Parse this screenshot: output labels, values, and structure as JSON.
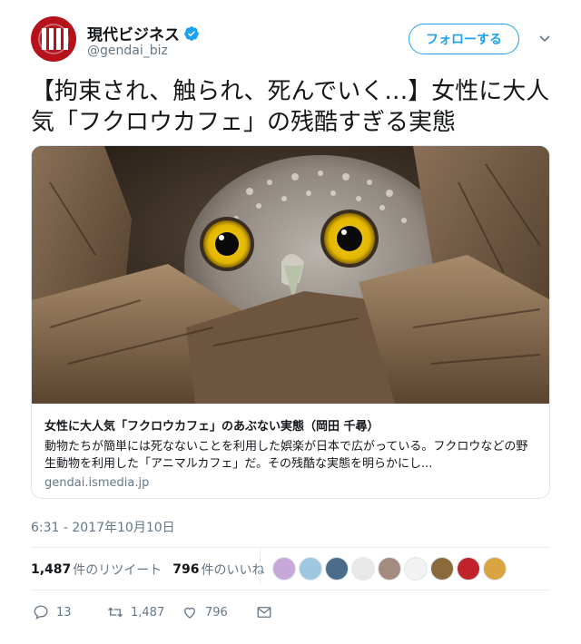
{
  "account": {
    "display_name": "現代ビジネス",
    "handle": "@gendai_biz",
    "verified": true,
    "avatar_color": "#b5121b"
  },
  "follow_button": {
    "label": "フォローする",
    "color": "#1da1f2"
  },
  "tweet": {
    "text": "【拘束され、触られ、死んでいく…】女性に大人気「フクロウカフェ」の残酷すぎる実態"
  },
  "card": {
    "image": "owl-peeking-from-tree-hollow",
    "title": "女性に大人気「フクロウカフェ」のあぶない実態（岡田 千尋）",
    "description": "動物たちが簡単には死なないことを利用した娯楽が日本で広がっている。フクロウなどの野生動物を利用した「アニマルカフェ」だ。その残酷な実態を明らかにし...",
    "domain": "gendai.ismedia.jp"
  },
  "timestamp": "6:31 - 2017年10月10日",
  "stats": {
    "retweets_count": "1,487",
    "retweets_label": "件のリツイート",
    "likes_count": "796",
    "likes_label": "件のいいね"
  },
  "likers": [
    {
      "icon": "liker-avatar",
      "color": "#c7a8d9"
    },
    {
      "icon": "liker-avatar",
      "color": "#9fc7e0"
    },
    {
      "icon": "liker-avatar",
      "color": "#4a6b8a"
    },
    {
      "icon": "liker-avatar",
      "color": "#e8e8e8"
    },
    {
      "icon": "liker-avatar",
      "color": "#a58b7d"
    },
    {
      "icon": "liker-avatar",
      "color": "#f2f2f2"
    },
    {
      "icon": "liker-avatar",
      "color": "#8a6a3a"
    },
    {
      "icon": "liker-avatar",
      "color": "#c0242a"
    },
    {
      "icon": "liker-avatar",
      "color": "#d9a441"
    }
  ],
  "actions": {
    "reply": {
      "icon": "reply-icon",
      "count": "13"
    },
    "retweet": {
      "icon": "retweet-icon",
      "count": "1,487"
    },
    "like": {
      "icon": "heart-icon",
      "count": "796"
    },
    "message": {
      "icon": "direct-message-icon"
    }
  }
}
